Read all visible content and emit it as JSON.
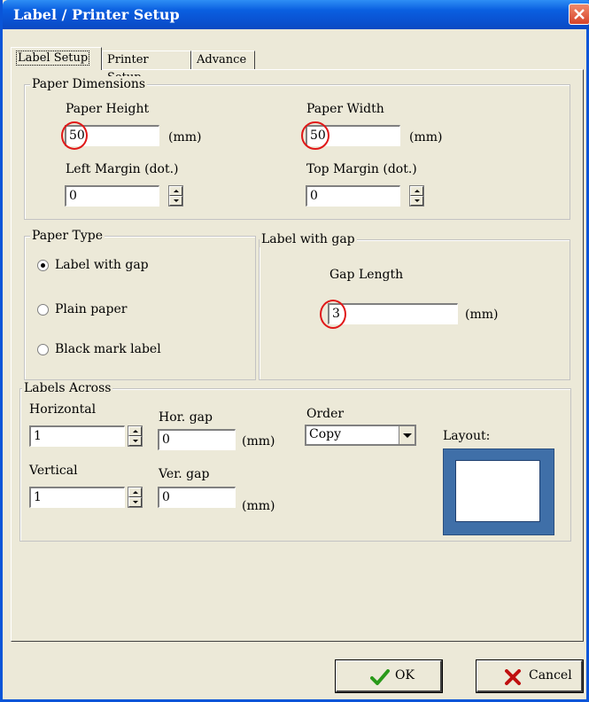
{
  "window": {
    "title": "Label / Printer Setup"
  },
  "tabs": [
    {
      "label": "Label Setup",
      "active": true
    },
    {
      "label": "Printer Setup",
      "active": false
    },
    {
      "label": "Advance",
      "active": false
    }
  ],
  "paper_dimensions": {
    "title": "Paper Dimensions",
    "height_label": "Paper Height",
    "height_value": "50",
    "height_unit": "(mm)",
    "width_label": "Paper Width",
    "width_value": "50",
    "width_unit": "(mm)",
    "left_margin_label": "Left Margin (dot.)",
    "left_margin_value": "0",
    "top_margin_label": "Top Margin (dot.)",
    "top_margin_value": "0"
  },
  "paper_type": {
    "title": "Paper Type",
    "options": [
      "Label with gap",
      "Plain paper",
      "Black mark label"
    ],
    "selected": "Label with gap"
  },
  "label_gap": {
    "title": "Label with gap",
    "gap_label": "Gap Length",
    "gap_value": "3",
    "gap_unit": "(mm)"
  },
  "labels_across": {
    "title": "Labels Across",
    "horizontal_label": "Horizontal",
    "horizontal_value": "1",
    "hor_gap_label": "Hor. gap",
    "hor_gap_value": "0",
    "hor_gap_unit": "(mm)",
    "vertical_label": "Vertical",
    "vertical_value": "1",
    "ver_gap_label": "Ver. gap",
    "ver_gap_value": "0",
    "ver_gap_unit": "(mm)",
    "order_label": "Order",
    "order_value": "Copy",
    "layout_label": "Layout:"
  },
  "buttons": {
    "ok": "OK",
    "cancel": "Cancel"
  },
  "colors": {
    "titlebar": "#0a52d2",
    "highlight_circle": "#e01818",
    "ok_check": "#2a9a1a",
    "cancel_x": "#c01010",
    "layout_preview": "#3f6fa8"
  },
  "icons": {
    "close": "close-icon",
    "ok": "checkmark-icon",
    "cancel": "x-icon"
  }
}
